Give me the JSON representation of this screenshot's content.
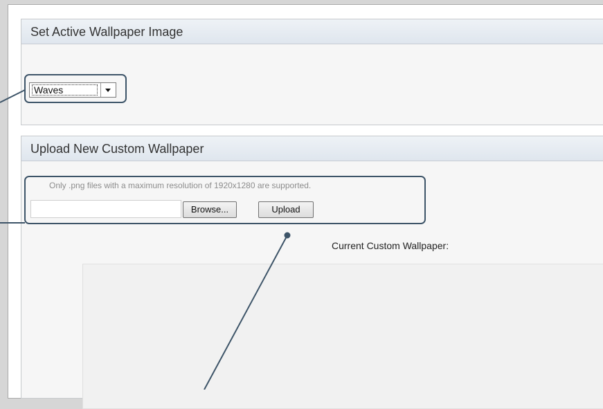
{
  "panels": {
    "wallpaper": {
      "title": "Set Active Wallpaper Image",
      "select": {
        "value": "Waves"
      }
    },
    "upload": {
      "title": "Upload New Custom Wallpaper",
      "hint": "Only .png files with a maximum resolution of 1920x1280 are supported.",
      "browse_label": "Browse...",
      "upload_label": "Upload",
      "current_label": "Current Custom Wallpaper:"
    }
  },
  "annotation_color": "#3d5468"
}
